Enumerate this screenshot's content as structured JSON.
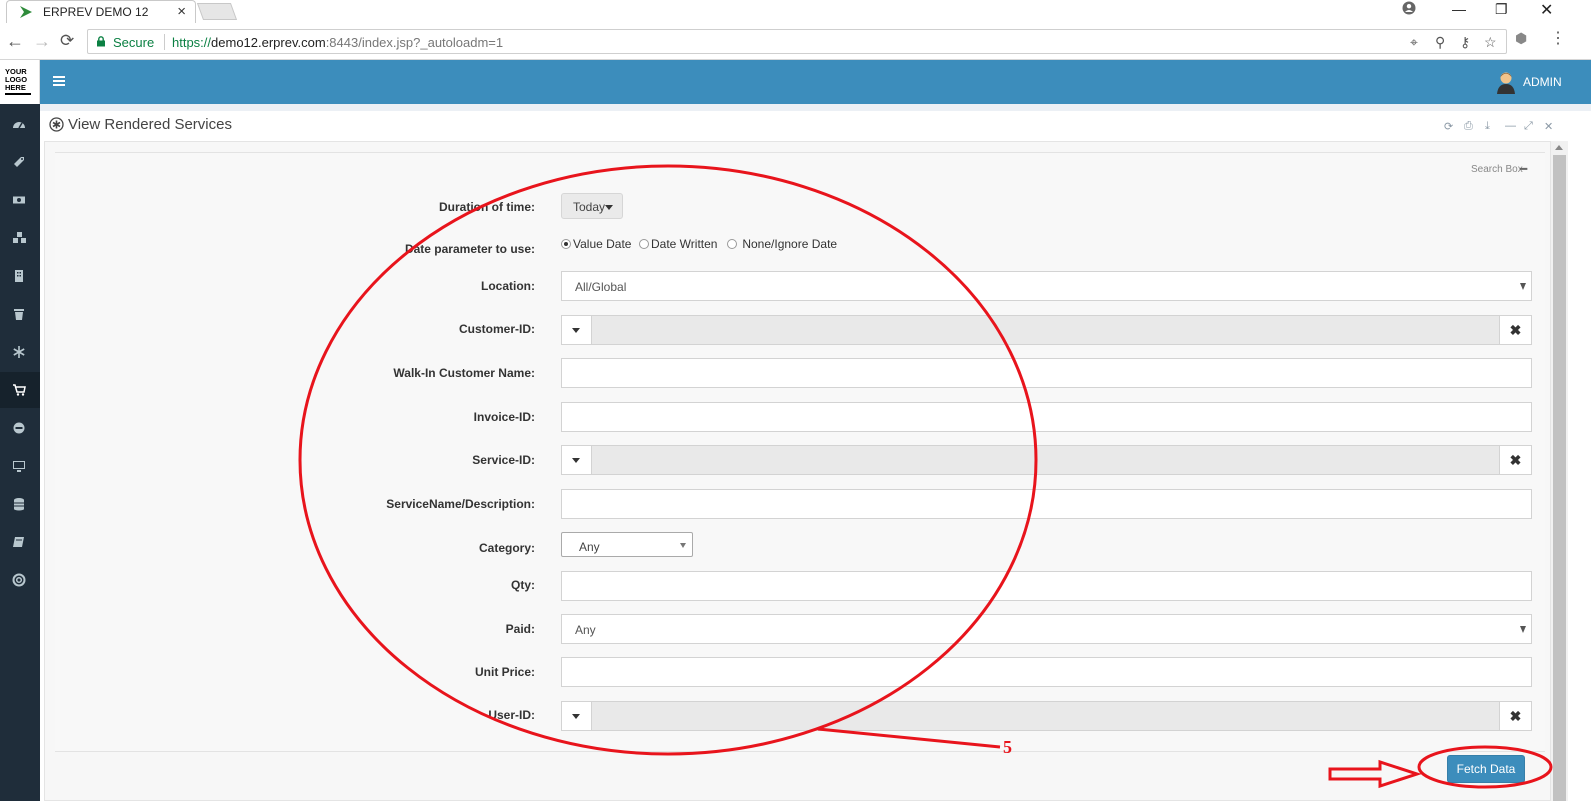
{
  "browser": {
    "tab_title": "ERPREV DEMO 12",
    "secure_label": "Secure",
    "url_scheme": "https://",
    "url_host": "demo12.erprev.com",
    "url_rest": ":8443/index.jsp?_autoloadm=1"
  },
  "app": {
    "logo_lines": [
      "YOUR",
      "LOGO",
      "HERE"
    ],
    "user_name": "ADMIN",
    "accent_color": "#3c8dbc",
    "sidebar_color": "#1f2d3a"
  },
  "sidebar": {
    "icons": [
      "dashboard-icon",
      "tag-icon",
      "money-icon",
      "cubes-icon",
      "building-icon",
      "trash-icon",
      "snowflake-icon",
      "cart-icon",
      "circle-icon",
      "desktop-icon",
      "database-icon",
      "book-icon",
      "lifebuoy-icon"
    ],
    "active_index": 7
  },
  "panel": {
    "title": "View Rendered Services",
    "search_box_label": "Search Box"
  },
  "form": {
    "duration_label": "Duration of time:",
    "duration_value": "Today",
    "date_param_label": "Date parameter to use:",
    "date_options": [
      "Value Date",
      "Date Written",
      "None/Ignore Date"
    ],
    "date_selected": "Value Date",
    "location_label": "Location:",
    "location_value": "All/Global",
    "customer_id_label": "Customer-ID:",
    "walkin_label": "Walk-In Customer Name:",
    "invoice_label": "Invoice-ID:",
    "service_id_label": "Service-ID:",
    "service_name_label": "ServiceName/Description:",
    "category_label": "Category:",
    "category_value": "Any",
    "qty_label": "Qty:",
    "paid_label": "Paid:",
    "paid_value": "Any",
    "unit_price_label": "Unit Price:",
    "user_id_label": "User-ID:",
    "fetch_label": "Fetch Data"
  },
  "annotation": {
    "number": "5",
    "color": "#e8141c"
  }
}
